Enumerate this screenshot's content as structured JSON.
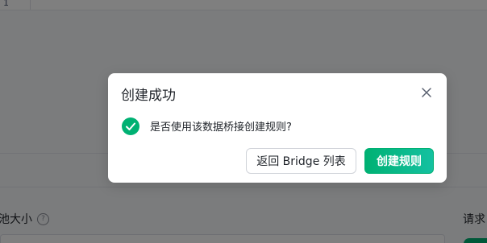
{
  "background": {
    "editor": {
      "line_number": "1"
    },
    "form": {
      "pool_size_label": "池大小",
      "help_icon": "?",
      "request_label": "请求"
    }
  },
  "dialog": {
    "title": "创建成功",
    "message": "是否使用该数据桥接创建规则?",
    "icons": {
      "close": "close-icon",
      "status": "success-check-icon"
    },
    "buttons": {
      "back_label": "返回 Bridge 列表",
      "create_rule_label": "创建规则"
    }
  },
  "colors": {
    "accent": "#00b173",
    "accent_gradient_end": "#14c1a1",
    "mask": "rgba(0,0,0,0.5)"
  }
}
